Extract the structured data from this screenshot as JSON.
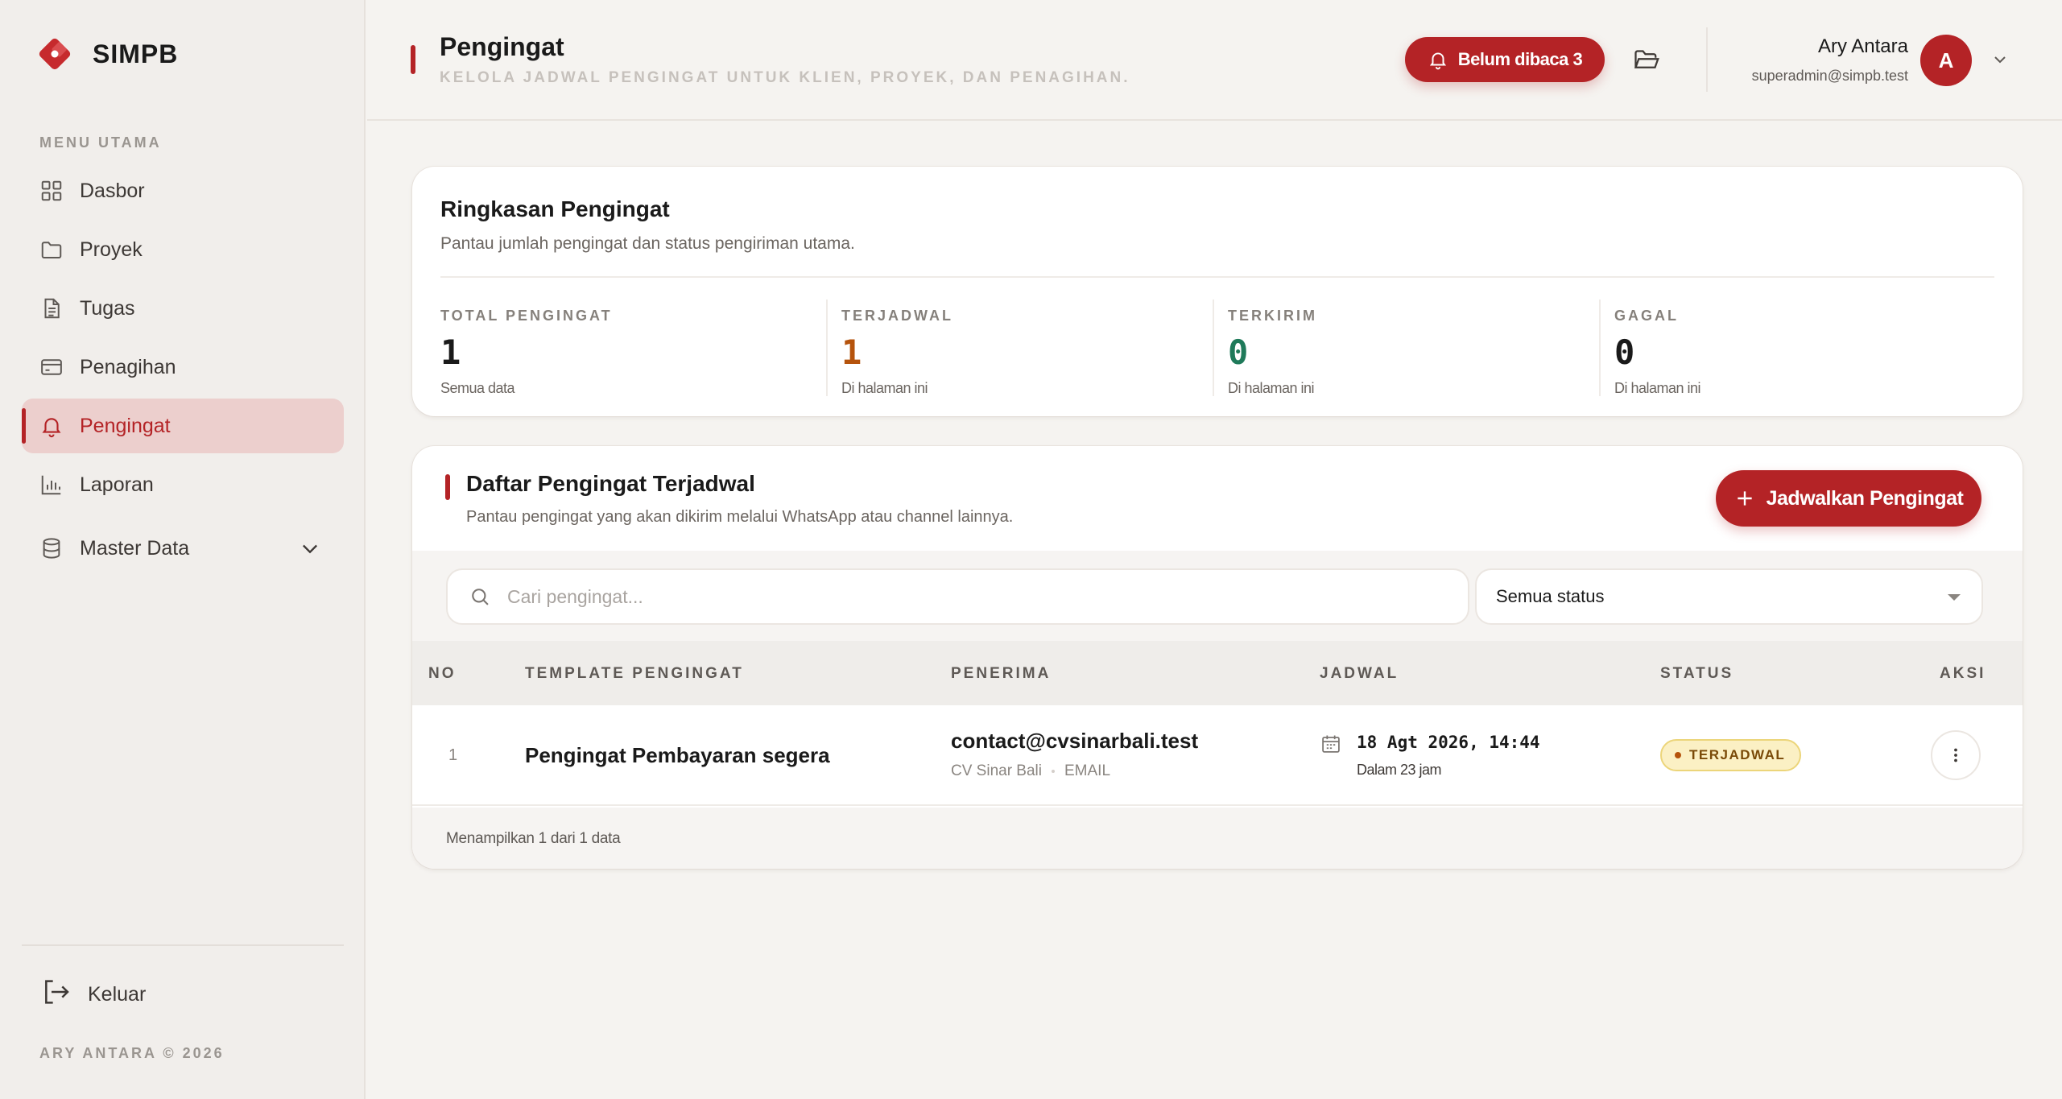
{
  "app": {
    "name": "SIMPB"
  },
  "sidebar": {
    "heading": "MENU UTAMA",
    "items": [
      {
        "label": "Dasbor",
        "icon": "grid-icon"
      },
      {
        "label": "Proyek",
        "icon": "folder-icon"
      },
      {
        "label": "Tugas",
        "icon": "document-icon"
      },
      {
        "label": "Penagihan",
        "icon": "credit-card-icon"
      },
      {
        "label": "Pengingat",
        "icon": "bell-icon",
        "active": true
      },
      {
        "label": "Laporan",
        "icon": "bar-chart-icon"
      },
      {
        "label": "Master Data",
        "icon": "database-icon",
        "expandable": true
      }
    ],
    "logout_label": "Keluar",
    "copyright": "ARY ANTARA © 2026"
  },
  "header": {
    "title": "Pengingat",
    "subtitle": "KELOLA JADWAL PENGINGAT UNTUK KLIEN, PROYEK, DAN PENAGIHAN.",
    "unread_label": "Belum dibaca 3",
    "user": {
      "name": "Ary Antara",
      "email": "superadmin@simpb.test",
      "initial": "A"
    }
  },
  "summary": {
    "title": "Ringkasan Pengingat",
    "subtitle": "Pantau jumlah pengingat dan status pengiriman utama.",
    "stats": [
      {
        "label": "TOTAL PENGINGAT",
        "value": "1",
        "note": "Semua data",
        "color": "#1a1a1a"
      },
      {
        "label": "TERJADWAL",
        "value": "1",
        "note": "Di halaman ini",
        "color": "#b5530c"
      },
      {
        "label": "TERKIRIM",
        "value": "0",
        "note": "Di halaman ini",
        "color": "#1f7a5a"
      },
      {
        "label": "GAGAL",
        "value": "0",
        "note": "Di halaman ini",
        "color": "#1a1a1a"
      }
    ]
  },
  "list": {
    "title": "Daftar Pengingat Terjadwal",
    "subtitle": "Pantau pengingat yang akan dikirim melalui WhatsApp atau channel lainnya.",
    "schedule_button": "Jadwalkan Pengingat",
    "search_placeholder": "Cari pengingat...",
    "status_filter": "Semua status",
    "columns": [
      "NO",
      "TEMPLATE PENGINGAT",
      "PENERIMA",
      "JADWAL",
      "STATUS",
      "AKSI"
    ],
    "rows": [
      {
        "no": "1",
        "template": "Pengingat Pembayaran segera",
        "recipient_email": "contact@cvsinarbali.test",
        "recipient_name": "CV Sinar Bali",
        "channel": "EMAIL",
        "date": "18 Agt 2026, 14:44",
        "relative": "Dalam 23 jam",
        "status": "TERJADWAL"
      }
    ],
    "footer": "Menampilkan 1 dari 1 data"
  },
  "colors": {
    "accent": "#b42326",
    "active_bg": "#eccfcd",
    "background": "#f5f3f0"
  }
}
